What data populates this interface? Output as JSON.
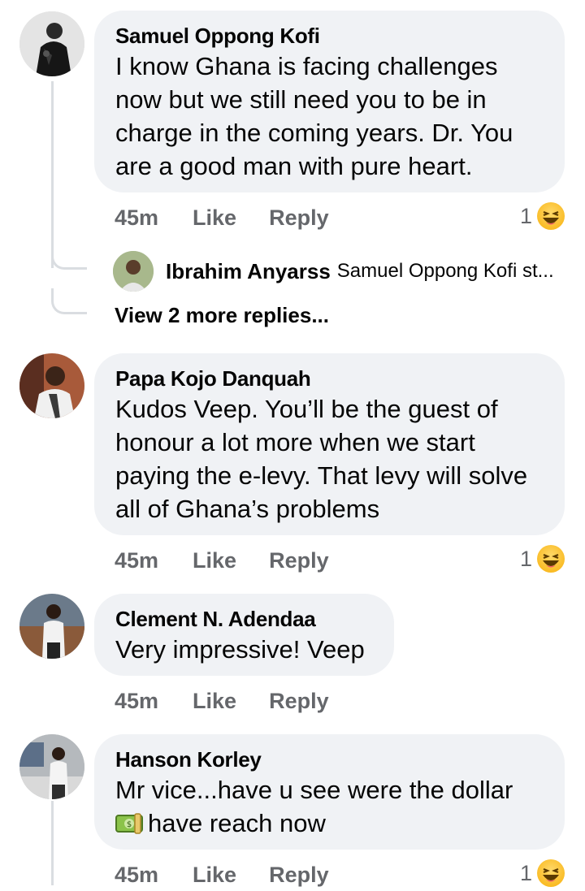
{
  "comments": [
    {
      "author": "Samuel Oppong Kofi",
      "text": "I know Ghana is facing challenges now but we still need you to be in charge in the coming years. Dr. You are a good man with pure heart.",
      "lines": [
        "I know Ghana is facing challenges",
        "now but we still need you to be in",
        "charge in the coming years. Dr. You",
        "are a good man with pure heart."
      ],
      "time": "45m",
      "like_label": "Like",
      "reply_label": "Reply",
      "reaction_count": "1",
      "reaction_icon": "haha-reaction-icon",
      "replies_preview": {
        "author": "Ibrahim Anyarss",
        "snippet": "Samuel Oppong Kofi st..."
      },
      "view_more_label": "View 2 more replies..."
    },
    {
      "author": "Papa Kojo Danquah",
      "lines": [
        "Kudos Veep. You’ll be the guest of",
        "honour a lot more when we start",
        "paying the e-levy. That levy will solve",
        "all of Ghana’s problems"
      ],
      "time": "45m",
      "like_label": "Like",
      "reply_label": "Reply",
      "reaction_count": "1",
      "reaction_icon": "haha-reaction-icon"
    },
    {
      "author": "Clement N. Adendaa",
      "lines": [
        "Very impressive! Veep"
      ],
      "time": "45m",
      "like_label": "Like",
      "reply_label": "Reply"
    },
    {
      "author": "Hanson Korley",
      "lines": [
        "Mr vice...have u see were the dollar",
        "have reach now"
      ],
      "inline_icon": "dollar-banknote-icon",
      "time": "45m",
      "like_label": "Like",
      "reply_label": "Reply",
      "reaction_count": "1",
      "reaction_icon": "haha-reaction-icon"
    }
  ],
  "colors": {
    "bubble": "#f0f2f5",
    "meta_text": "#65676b",
    "thread_line": "#dadde1",
    "reaction": "#f9b81d"
  }
}
